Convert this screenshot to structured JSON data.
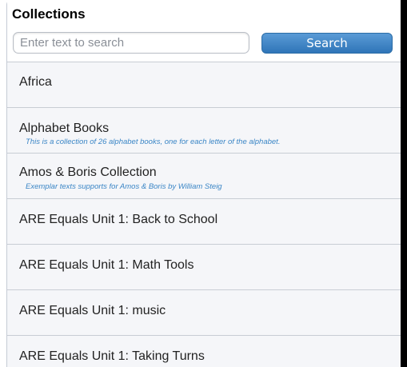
{
  "header": {
    "title": "Collections"
  },
  "search": {
    "placeholder": "Enter text to search",
    "value": "",
    "button_label": "Search"
  },
  "collections": [
    {
      "title": "Africa",
      "description": ""
    },
    {
      "title": "Alphabet Books",
      "description": "This is a collection of 26 alphabet books, one for each letter of the alphabet."
    },
    {
      "title": "Amos & Boris Collection",
      "description": "Exemplar texts supports for Amos & Boris by William Steig"
    },
    {
      "title": "ARE Equals Unit 1: Back to School",
      "description": ""
    },
    {
      "title": "ARE Equals Unit 1: Math Tools",
      "description": ""
    },
    {
      "title": "ARE Equals Unit 1: music",
      "description": ""
    },
    {
      "title": "ARE Equals Unit 1: Taking Turns",
      "description": ""
    }
  ]
}
